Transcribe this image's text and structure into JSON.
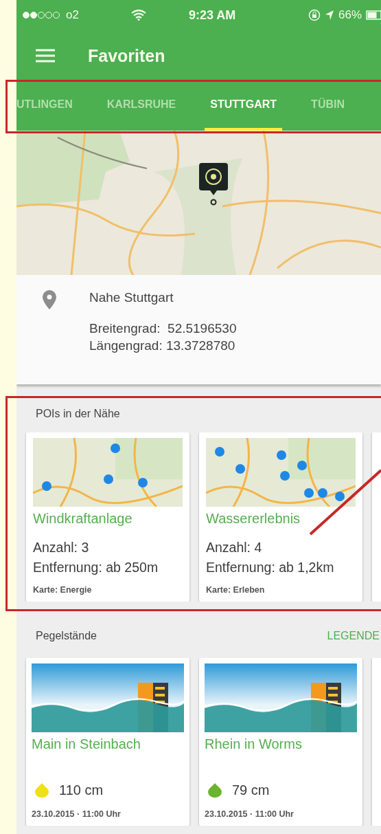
{
  "status_bar": {
    "carrier": "o2",
    "time": "9:23 AM",
    "battery": "66%"
  },
  "app_bar": {
    "title": "Favoriten"
  },
  "tabs": [
    {
      "label": "UTLINGEN",
      "selected": false
    },
    {
      "label": "KARLSRUHE",
      "selected": false
    },
    {
      "label": "STUTTGART",
      "selected": true
    },
    {
      "label": "TÜBIN",
      "selected": false
    }
  ],
  "location": {
    "name": "Nahe Stuttgart",
    "latitude": "Breitengrad:  52.5196530",
    "longitude": "Längengrad: 13.3728780"
  },
  "pois": {
    "title": "POIs in der Nähe",
    "cards": [
      {
        "name": "Windkraftanlage",
        "count": "Anzahl: 3",
        "distance": "Entfernung: ab 250m",
        "map": "Karte: Energie"
      },
      {
        "name": "Wassererlebnis",
        "count": "Anzahl: 4",
        "distance": "Entfernung: ab 1,2km",
        "map": "Karte: Erleben"
      }
    ]
  },
  "gauges": {
    "title": "Pegelstände",
    "action": "LEGENDE",
    "cards": [
      {
        "name": "Main in Steinbach",
        "reading": "110 cm",
        "color": "#f0e016",
        "time": "23.10.2015 · 11:00 Uhr"
      },
      {
        "name": "Rhein in Worms",
        "reading": "79 cm",
        "color": "#6ab42e",
        "time": "23.10.2015 · 11:00 Uhr"
      }
    ]
  }
}
